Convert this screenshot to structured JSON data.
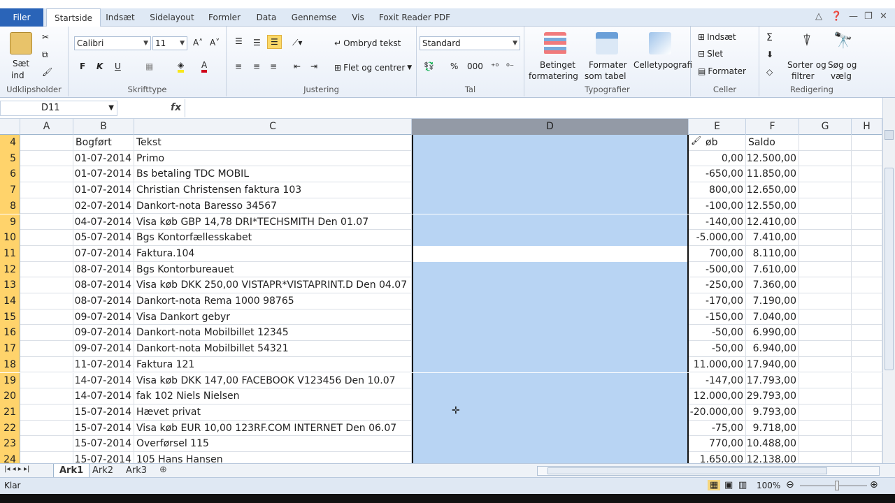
{
  "menu": {
    "file": "Filer",
    "tabs": [
      "Startside",
      "Indsæt",
      "Sidelayout",
      "Formler",
      "Data",
      "Gennemse",
      "Vis",
      "Foxit Reader PDF"
    ]
  },
  "ribbon": {
    "clipboard": {
      "paste_line1": "Sæt",
      "paste_line2": "ind",
      "label": "Udklipsholder"
    },
    "font": {
      "name": "Calibri",
      "size": "11",
      "bold": "F",
      "italic": "K",
      "underline": "U",
      "label": "Skrifttype"
    },
    "alignment": {
      "wrap": "Ombryd tekst",
      "merge": "Flet og centrer",
      "label": "Justering"
    },
    "number": {
      "format": "Standard",
      "percent": "%",
      "thousands": "000",
      "label": "Tal"
    },
    "styles": {
      "conditional_line1": "Betinget",
      "conditional_line2": "formatering",
      "table_line1": "Formater",
      "table_line2": "som tabel",
      "cellstyles": "Celletypografi",
      "label": "Typografier"
    },
    "cells": {
      "insert": "Indsæt",
      "delete": "Slet",
      "format": "Formater",
      "label": "Celler"
    },
    "editing": {
      "sum": "Σ",
      "sort_line1": "Sorter og",
      "sort_line2": "filtrer",
      "find_line1": "Søg og",
      "find_line2": "vælg",
      "label": "Redigering"
    }
  },
  "formula_bar": {
    "name_box": "D11",
    "fx": "fx",
    "value": ""
  },
  "columns": [
    "A",
    "B",
    "C",
    "D",
    "E",
    "F",
    "G",
    "H"
  ],
  "rows": [
    {
      "n": "4",
      "date": "Bogført",
      "text": "Tekst",
      "amount": "øb",
      "balance": "Saldo"
    },
    {
      "n": "5",
      "date": "01-07-2014",
      "text": "Primo",
      "amount": "0,00",
      "balance": "12.500,00"
    },
    {
      "n": "6",
      "date": "01-07-2014",
      "text": "Bs betaling TDC MOBIL",
      "amount": "-650,00",
      "balance": "11.850,00"
    },
    {
      "n": "7",
      "date": "01-07-2014",
      "text": "Christian Christensen faktura 103",
      "amount": "800,00",
      "balance": "12.650,00"
    },
    {
      "n": "8",
      "date": "02-07-2014",
      "text": "Dankort-nota Baresso 34567",
      "amount": "-100,00",
      "balance": "12.550,00"
    },
    {
      "n": "9",
      "date": "04-07-2014",
      "text": "Visa køb GBP 14,78 DRI*TECHSMITH Den 01.07",
      "amount": "-140,00",
      "balance": "12.410,00"
    },
    {
      "n": "10",
      "date": "05-07-2014",
      "text": "Bgs Kontorfællesskabet",
      "amount": "-5.000,00",
      "balance": "7.410,00"
    },
    {
      "n": "11",
      "date": "07-07-2014",
      "text": "Faktura.104",
      "amount": "700,00",
      "balance": "8.110,00"
    },
    {
      "n": "12",
      "date": "08-07-2014",
      "text": "Bgs Kontorbureauet",
      "amount": "-500,00",
      "balance": "7.610,00"
    },
    {
      "n": "13",
      "date": "08-07-2014",
      "text": "Visa køb DKK 250,00 VISTAPR*VISTAPRINT.D Den 04.07",
      "amount": "-250,00",
      "balance": "7.360,00"
    },
    {
      "n": "14",
      "date": "08-07-2014",
      "text": "Dankort-nota Rema 1000 98765",
      "amount": "-170,00",
      "balance": "7.190,00"
    },
    {
      "n": "15",
      "date": "09-07-2014",
      "text": "Visa Dankort gebyr",
      "amount": "-150,00",
      "balance": "7.040,00"
    },
    {
      "n": "16",
      "date": "09-07-2014",
      "text": "Dankort-nota Mobilbillet 12345",
      "amount": "-50,00",
      "balance": "6.990,00"
    },
    {
      "n": "17",
      "date": "09-07-2014",
      "text": "Dankort-nota Mobilbillet 54321",
      "amount": "-50,00",
      "balance": "6.940,00"
    },
    {
      "n": "18",
      "date": "11-07-2014",
      "text": "Faktura 121",
      "amount": "11.000,00",
      "balance": "17.940,00"
    },
    {
      "n": "19",
      "date": "14-07-2014",
      "text": "Visa køb DKK 147,00 FACEBOOK V123456 Den 10.07",
      "amount": "-147,00",
      "balance": "17.793,00"
    },
    {
      "n": "20",
      "date": "14-07-2014",
      "text": "fak 102 Niels Nielsen",
      "amount": "12.000,00",
      "balance": "29.793,00"
    },
    {
      "n": "21",
      "date": "15-07-2014",
      "text": "Hævet privat",
      "amount": "-20.000,00",
      "balance": "9.793,00"
    },
    {
      "n": "22",
      "date": "15-07-2014",
      "text": "Visa køb EUR 10,00 123RF.COM  INTERNET Den 06.07",
      "amount": "-75,00",
      "balance": "9.718,00"
    },
    {
      "n": "23",
      "date": "15-07-2014",
      "text": "Overførsel 115",
      "amount": "770,00",
      "balance": "10.488,00"
    },
    {
      "n": "24",
      "date": "15-07-2014",
      "text": "105 Hans Hansen",
      "amount": "1.650,00",
      "balance": "12.138,00"
    }
  ],
  "sheets": [
    "Ark1",
    "Ark2",
    "Ark3"
  ],
  "status": {
    "ready": "Klar",
    "zoom": "100%"
  },
  "colors": {
    "selection": "#b8d4f3",
    "accent": "#2a64b8",
    "row_header_selected": "#ffd36b"
  }
}
